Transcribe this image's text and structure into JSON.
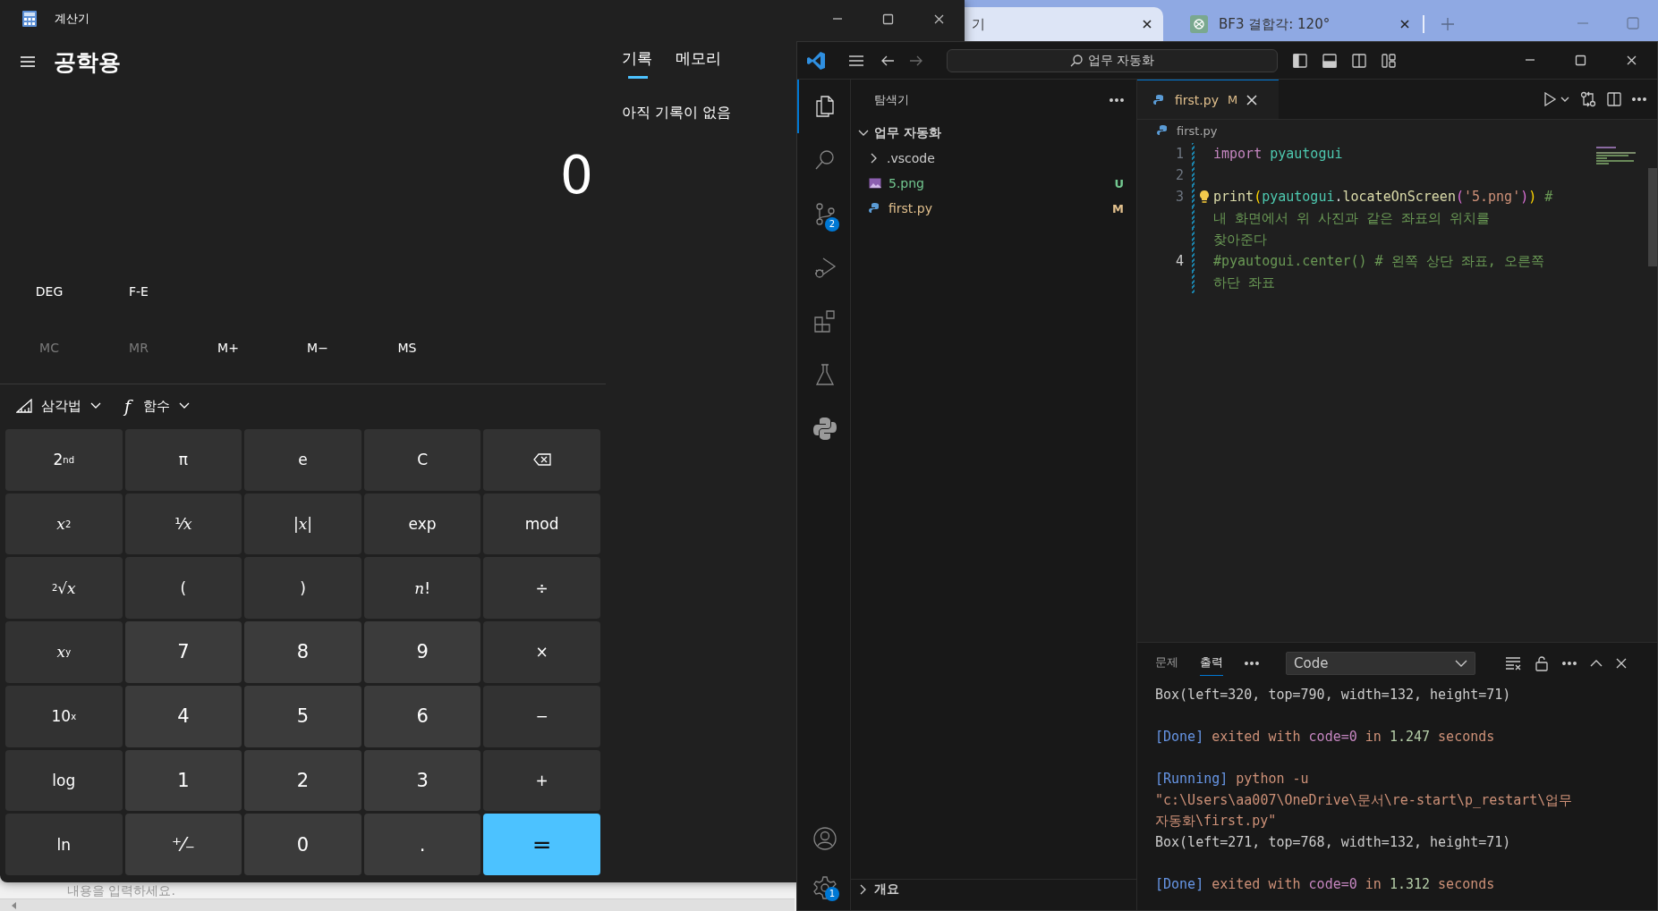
{
  "browser": {
    "tabs": [
      {
        "title": "기",
        "selected": true,
        "favicon": false
      },
      {
        "title": "BF3 결합각: 120°",
        "selected": false,
        "favicon": true
      }
    ],
    "hint": "내용을 입력하세요."
  },
  "calculator": {
    "title": "계산기",
    "mode": "공학용",
    "display": "0",
    "side_tabs": [
      {
        "label": "기록",
        "selected": true
      },
      {
        "label": "메모리",
        "selected": false
      }
    ],
    "history_empty": "아직 기록이 없음",
    "toggles": [
      "DEG",
      "F-E"
    ],
    "memory": [
      {
        "label": "MC",
        "disabled": true
      },
      {
        "label": "MR",
        "disabled": true
      },
      {
        "label": "M+",
        "disabled": false
      },
      {
        "label": "M−",
        "disabled": false
      },
      {
        "label": "MS",
        "disabled": false
      }
    ],
    "menus": [
      {
        "kind": "trig",
        "label": "삼각법"
      },
      {
        "kind": "func",
        "glyph": "f",
        "label": "함수"
      }
    ],
    "keys": [
      {
        "kind": "func",
        "label": "2$^{nd}$"
      },
      {
        "kind": "func",
        "label": "π"
      },
      {
        "kind": "func",
        "label": "e"
      },
      {
        "kind": "func",
        "label": "C"
      },
      {
        "kind": "backspace"
      },
      {
        "kind": "func",
        "label": "*x*$^{2}$"
      },
      {
        "kind": "func",
        "label": "¹⁄*x*"
      },
      {
        "kind": "func",
        "label": "|*x*|"
      },
      {
        "kind": "func",
        "label": "exp"
      },
      {
        "kind": "func",
        "label": "mod"
      },
      {
        "kind": "func",
        "label": "$^{2}$√*x*"
      },
      {
        "kind": "func",
        "label": "("
      },
      {
        "kind": "func",
        "label": ")"
      },
      {
        "kind": "func",
        "label": "*n*!"
      },
      {
        "kind": "func",
        "label": "÷"
      },
      {
        "kind": "func",
        "label": "*x*$^{y}$"
      },
      {
        "kind": "digit",
        "label": "7"
      },
      {
        "kind": "digit",
        "label": "8"
      },
      {
        "kind": "digit",
        "label": "9"
      },
      {
        "kind": "func",
        "label": "×"
      },
      {
        "kind": "func",
        "label": "10$^{x}$"
      },
      {
        "kind": "digit",
        "label": "4"
      },
      {
        "kind": "digit",
        "label": "5"
      },
      {
        "kind": "digit",
        "label": "6"
      },
      {
        "kind": "func",
        "label": "−"
      },
      {
        "kind": "func",
        "label": "log"
      },
      {
        "kind": "digit",
        "label": "1"
      },
      {
        "kind": "digit",
        "label": "2"
      },
      {
        "kind": "digit",
        "label": "3"
      },
      {
        "kind": "func",
        "label": "+"
      },
      {
        "kind": "func",
        "label": "ln"
      },
      {
        "kind": "digit",
        "label": "⁺⁄₋"
      },
      {
        "kind": "digit",
        "label": "0"
      },
      {
        "kind": "digit",
        "label": "."
      },
      {
        "kind": "equals",
        "label": "="
      }
    ]
  },
  "vscode": {
    "search": "업무 자동화",
    "activity": [
      {
        "kind": "files",
        "selected": true
      },
      {
        "kind": "search",
        "selected": false
      },
      {
        "kind": "scm",
        "selected": false,
        "badge": "2"
      },
      {
        "kind": "run",
        "selected": false
      },
      {
        "kind": "extensions",
        "selected": false
      },
      {
        "kind": "testing",
        "selected": false
      },
      {
        "kind": "python",
        "selected": false
      }
    ],
    "manage_badge": "1",
    "explorer": {
      "title": "탐색기",
      "folder": "업무 자동화",
      "expanded": true,
      "items": [
        {
          "kind": "folder",
          "name": ".vscode",
          "expanded": false
        },
        {
          "kind": "image",
          "name": "5.png",
          "status": "U",
          "color": "#73c991"
        },
        {
          "kind": "python",
          "name": "first.py",
          "status": "M",
          "color": "#e2c08d"
        }
      ],
      "outline": {
        "title": "개요",
        "expanded": false
      }
    },
    "editor": {
      "tab": {
        "title": "first.py",
        "status": "M",
        "color": "#e2c08d",
        "selected": true
      },
      "breadcrumb": "first.py",
      "lines": [
        {
          "number": "1",
          "current": false,
          "rows": [
            [
              {
                "kind": "keyword",
                "text": "import"
              },
              {
                "kind": "plain",
                "text": " "
              },
              {
                "kind": "module",
                "text": "pyautogui"
              }
            ]
          ]
        },
        {
          "number": "2",
          "current": false
        },
        {
          "number": "3",
          "current": false,
          "lightbulb": true,
          "rows": [
            [
              {
                "kind": "function",
                "text": "print"
              },
              {
                "kind": "bracket1",
                "text": "("
              },
              {
                "kind": "module",
                "text": "pyautogui"
              },
              {
                "kind": "plain",
                "text": "."
              },
              {
                "kind": "function",
                "text": "locateOnScreen"
              },
              {
                "kind": "bracket2",
                "text": "("
              },
              {
                "kind": "string",
                "text": "'5.png'"
              },
              {
                "kind": "bracket2",
                "text": ")"
              },
              {
                "kind": "bracket1",
                "text": ")"
              },
              {
                "kind": "comment",
                "text": " #"
              }
            ],
            [
              {
                "kind": "comment",
                "text": "내 화면에서 위 사진과 같은 좌표의 위치를"
              }
            ],
            [
              {
                "kind": "comment",
                "text": "찾아준다"
              }
            ]
          ]
        },
        {
          "number": "4",
          "current": true,
          "rows": [
            [
              {
                "kind": "comment",
                "text": "#pyautogui.center() # 왼쪽 상단 좌표, 오른쪽"
              }
            ],
            [
              {
                "kind": "comment",
                "text": "하단 좌표"
              }
            ]
          ]
        }
      ]
    },
    "panel": {
      "tabs": [
        {
          "label": "문제",
          "selected": false
        },
        {
          "label": "출력",
          "selected": true
        }
      ],
      "channel": "Code",
      "output": [
        {
          "segments": [
            {
              "kind": "plain",
              "text": "Box(left=320, top=790, width=132, height=71)"
            }
          ]
        },
        {
          "kind": "blank"
        },
        {
          "segments": [
            {
              "kind": "tag",
              "text": "[Done]"
            },
            {
              "kind": "text",
              "text": " exited with "
            },
            {
              "kind": "param",
              "text": "code=0"
            },
            {
              "kind": "text",
              "text": " in "
            },
            {
              "kind": "number",
              "text": "1.247"
            },
            {
              "kind": "text",
              "text": " seconds"
            }
          ]
        },
        {
          "kind": "blank"
        },
        {
          "segments": [
            {
              "kind": "tag",
              "text": "[Running]"
            },
            {
              "kind": "text",
              "text": " python -u"
            }
          ]
        },
        {
          "segments": [
            {
              "kind": "text",
              "text": "\"c:\\Users\\aa007\\OneDrive\\문서\\re-start\\p_restart\\업무"
            }
          ]
        },
        {
          "segments": [
            {
              "kind": "text",
              "text": "자동화\\first.py\""
            }
          ]
        },
        {
          "segments": [
            {
              "kind": "plain",
              "text": "Box(left=271, top=768, width=132, height=71)"
            }
          ]
        },
        {
          "kind": "blank"
        },
        {
          "segments": [
            {
              "kind": "tag",
              "text": "[Done]"
            },
            {
              "kind": "text",
              "text": " exited with "
            },
            {
              "kind": "param",
              "text": "code=0"
            },
            {
              "kind": "text",
              "text": " in "
            },
            {
              "kind": "number",
              "text": "1.312"
            },
            {
              "kind": "text",
              "text": " seconds"
            }
          ]
        }
      ]
    }
  }
}
